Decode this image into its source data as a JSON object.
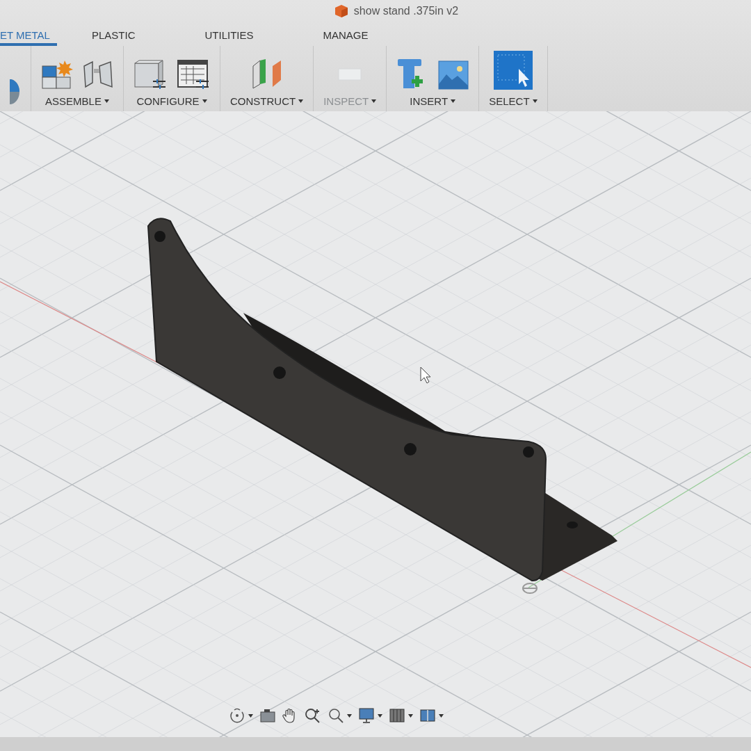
{
  "window": {
    "title": "show stand .375in v2"
  },
  "tabs": [
    {
      "label": "ET METAL",
      "selected": true
    },
    {
      "label": "PLASTIC",
      "selected": false
    },
    {
      "label": "UTILITIES",
      "selected": false
    },
    {
      "label": "MANAGE",
      "selected": false
    }
  ],
  "toolbar": [
    {
      "kind": "partial"
    },
    {
      "kind": "assemble",
      "label": "ASSEMBLE"
    },
    {
      "kind": "configure",
      "label": "CONFIGURE"
    },
    {
      "kind": "construct",
      "label": "CONSTRUCT"
    },
    {
      "kind": "inspect",
      "label": "INSPECT"
    },
    {
      "kind": "insert",
      "label": "INSERT"
    },
    {
      "kind": "select",
      "label": "SELECT"
    }
  ],
  "nav_bar": [
    {
      "kind": "orbit",
      "dropdown": true
    },
    {
      "kind": "look",
      "dropdown": false
    },
    {
      "kind": "pan",
      "dropdown": false
    },
    {
      "kind": "zoom",
      "dropdown": false
    },
    {
      "kind": "fit",
      "dropdown": true
    },
    {
      "kind": "display",
      "dropdown": true
    },
    {
      "kind": "grid",
      "dropdown": true
    },
    {
      "kind": "viewports",
      "dropdown": true
    }
  ]
}
